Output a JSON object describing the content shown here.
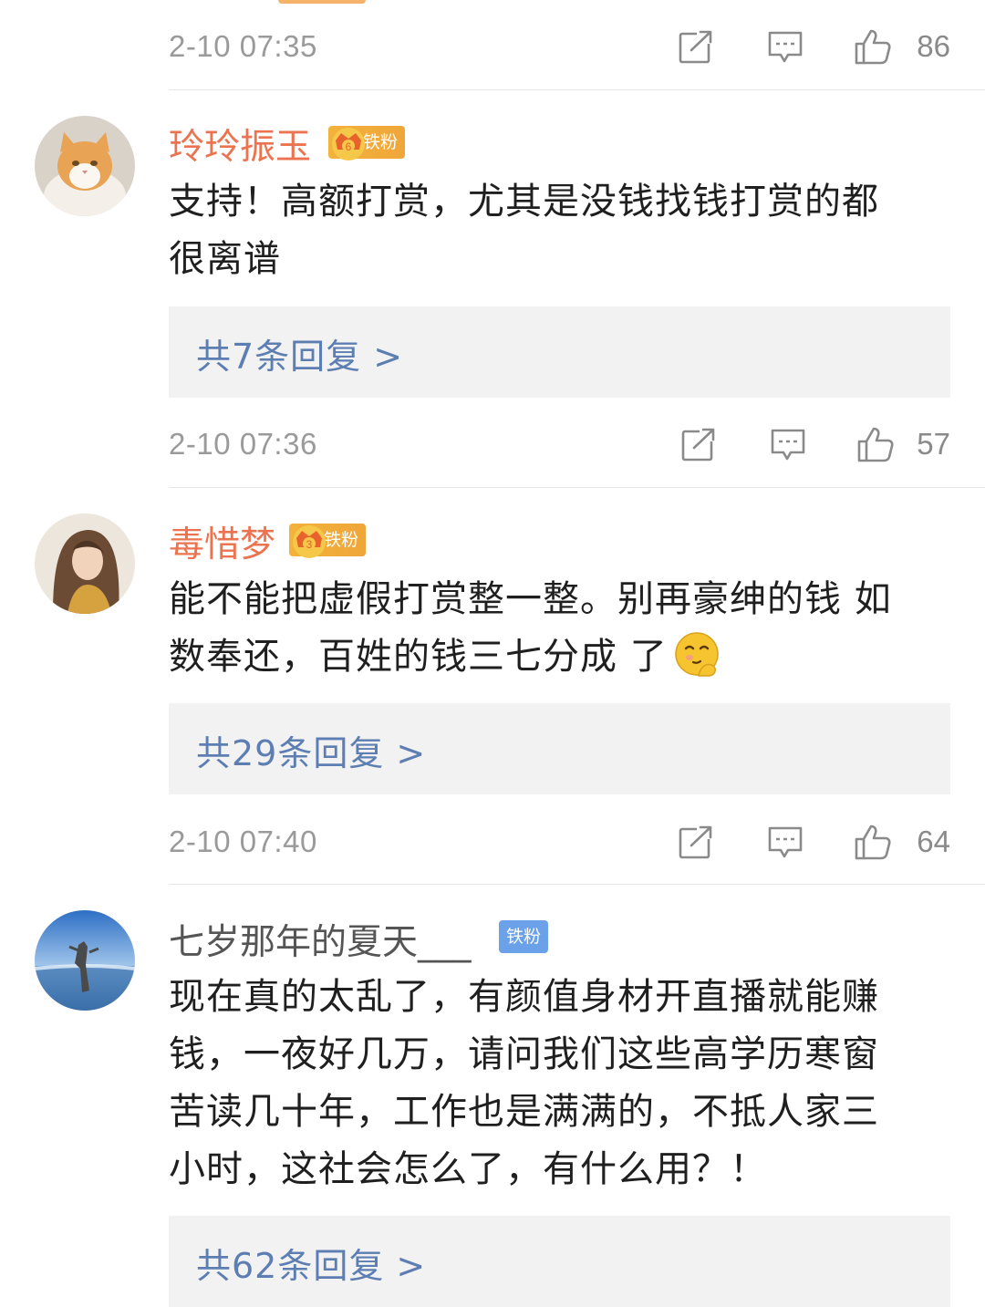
{
  "comments": [
    {
      "timestamp": "2-10 07:35",
      "likes": "86"
    },
    {
      "username": "玲玲振玉",
      "badge_label": "铁粉",
      "badge_level": "6",
      "text_line1": "支持！高额打赏，尤其是没钱找钱打赏的都",
      "text_line2": "很离谱",
      "reply_label": "共7条回复 >",
      "timestamp": "2-10 07:36",
      "likes": "57"
    },
    {
      "username": "毒惜梦",
      "badge_label": "铁粉",
      "badge_level": "3",
      "text_line1": "能不能把虚假打赏整一整。别再豪绅的钱 如",
      "text_line2": "数奉还，百姓的钱三七分成 了",
      "emoji": "think-emoji",
      "reply_label": "共29条回复 >",
      "timestamp": "2-10 07:40",
      "likes": "64"
    },
    {
      "username": "七岁那年的夏天___",
      "badge_label": "铁粉",
      "text_line1": "现在真的太乱了，有颜值身材开直播就能赚",
      "text_line2": "钱，一夜好几万，请问我们这些高学历寒窗",
      "text_line3": "苦读几十年，工作也是满满的，不抵人家三",
      "text_line4": "小时，这社会怎么了，有什么用？！",
      "reply_label": "共62条回复 >"
    }
  ],
  "icons": {
    "forward": "forward-icon",
    "comment": "comment-icon",
    "like": "thumbs-up-icon"
  },
  "colors": {
    "username_highlight": "#eb7350",
    "reply_link": "#5d7eb3",
    "badge_gold": "#f3b23b",
    "badge_blue": "#6aa1e8"
  }
}
